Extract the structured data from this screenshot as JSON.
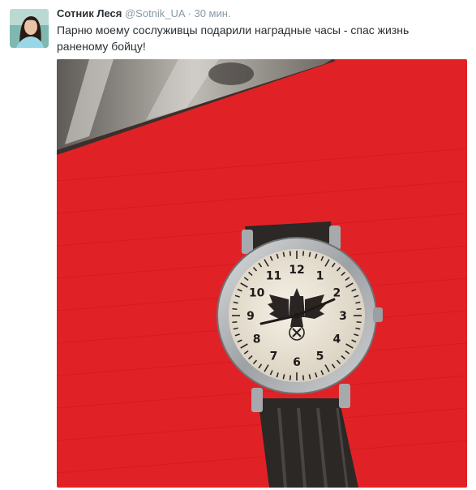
{
  "tweet": {
    "author_name": "Сотник Леся",
    "handle": "@Sotnik_UA",
    "separator": "·",
    "time": "30 мин.",
    "text": "Парню моему сослуживцы подарили наградные часы - спас жизнь раненому бойцу!"
  },
  "photo": {
    "dial_numbers": [
      "12",
      "1",
      "2",
      "3",
      "4",
      "5",
      "6",
      "7",
      "8",
      "9",
      "10",
      "11"
    ],
    "colors": {
      "tablecloth": "#e21f24",
      "case": "#b9bbbd",
      "dial": "#ece6d8",
      "strap": "#2b2826"
    }
  }
}
